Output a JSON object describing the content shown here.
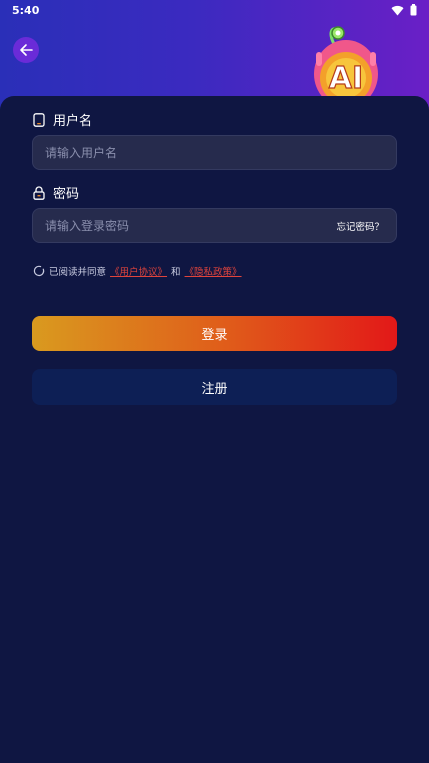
{
  "status_bar": {
    "time": "5:40"
  },
  "mascot": {
    "text": "AI"
  },
  "username": {
    "label": "用户名",
    "placeholder": "请输入用户名"
  },
  "password": {
    "label": "密码",
    "placeholder": "请输入登录密码",
    "forgot": "忘记密码？"
  },
  "agreement": {
    "prefix": "已阅读并同意",
    "user_agreement": "《用户协议》",
    "and": "和",
    "privacy_policy": "《隐私政策》",
    "checked": false
  },
  "buttons": {
    "login": "登录",
    "register": "注册"
  },
  "colors": {
    "header_start": "#2a2fb8",
    "header_end": "#6a1fc6",
    "background": "#0e1540",
    "card": "#0f1642",
    "field": "#262b4d",
    "link": "#e0443c",
    "login_start": "#d99a1f",
    "login_end": "#e21818",
    "register": "#0d1f55"
  },
  "icons": {
    "back": "arrow-left-icon",
    "phone": "phone-icon",
    "lock": "lock-icon",
    "wifi": "wifi-icon",
    "battery": "battery-icon",
    "checkbox": "circle-check-icon"
  }
}
